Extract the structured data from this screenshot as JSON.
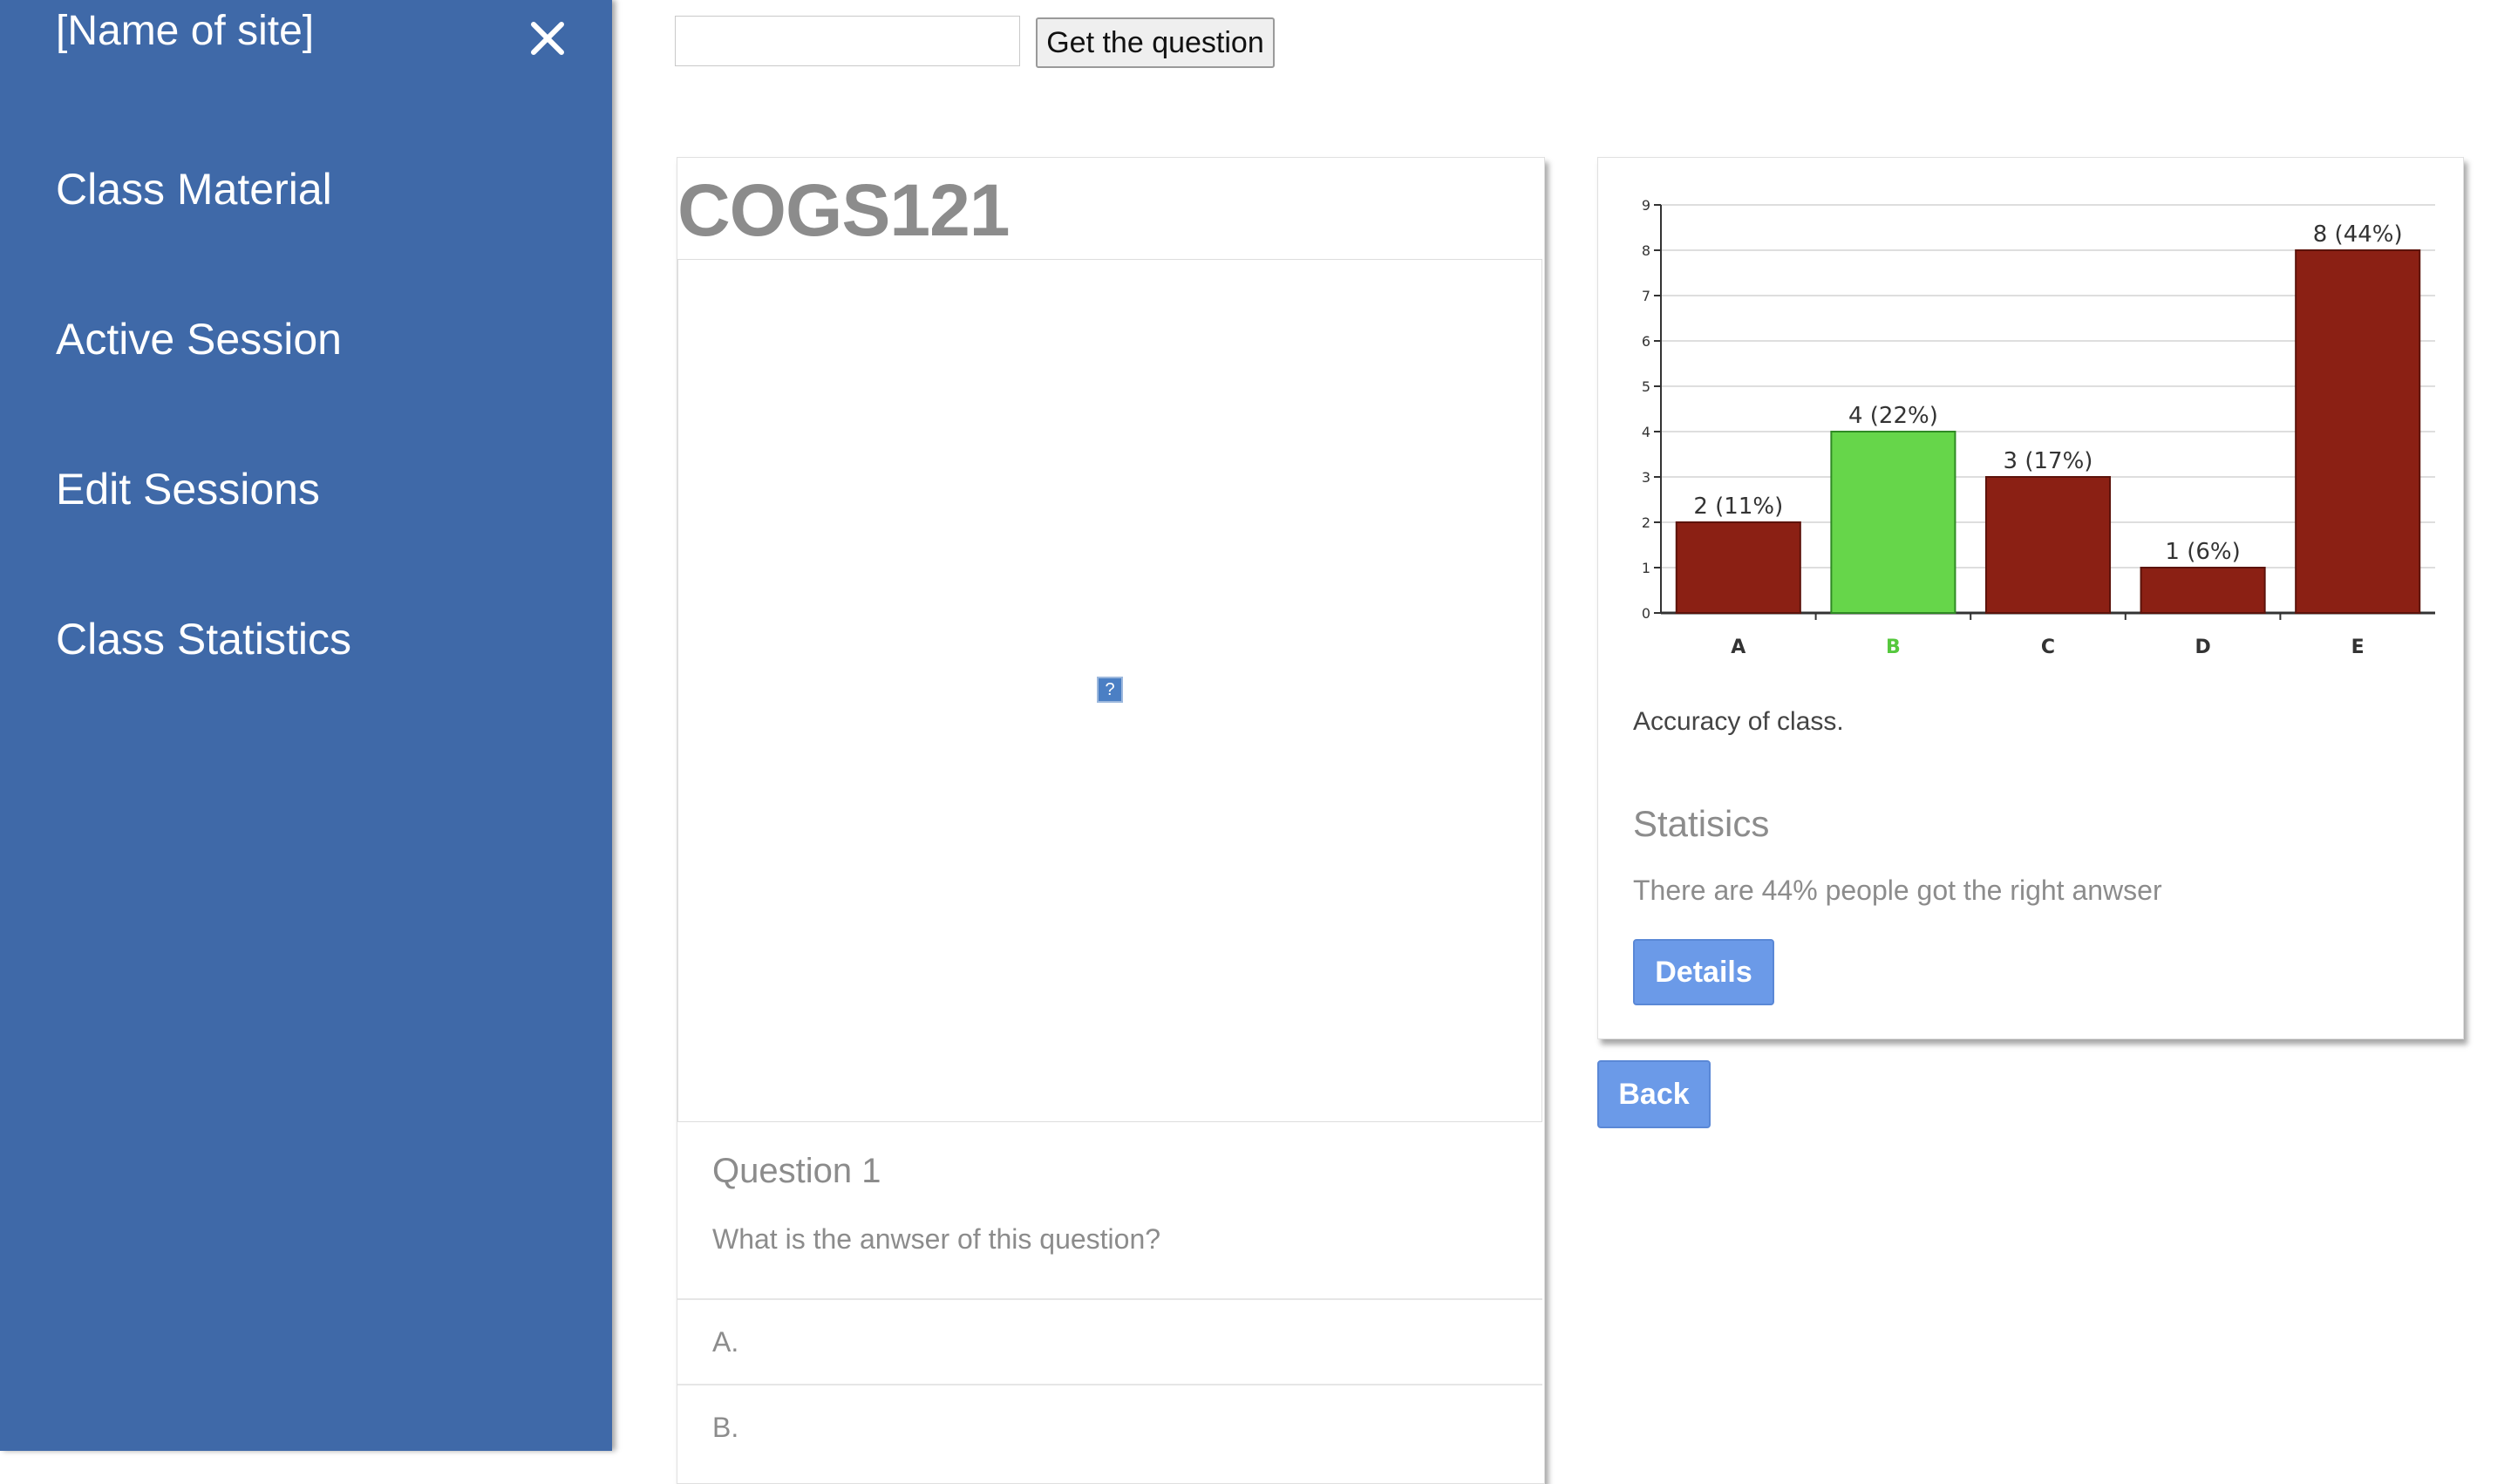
{
  "sidebar": {
    "site_name": "[Name of site]",
    "close_icon": "close-icon",
    "items": [
      {
        "label": "Class Material"
      },
      {
        "label": "Active Session"
      },
      {
        "label": "Edit Sessions"
      },
      {
        "label": "Class Statistics"
      }
    ]
  },
  "topbar": {
    "input_value": "",
    "button_label": "Get the question"
  },
  "question_card": {
    "course": "COGS121",
    "image_icon": "broken-image-icon",
    "question_label": "Question 1",
    "question_text": "What is the anwser of this question?",
    "options": [
      {
        "label": "A."
      },
      {
        "label": "B."
      }
    ]
  },
  "stats_card": {
    "caption": "Accuracy of class.",
    "heading": "Statisics",
    "text": "There are 44% people got the right anwser",
    "details_label": "Details"
  },
  "back_label": "Back",
  "colors": {
    "sidebar": "#3f69a8",
    "bar_wrong": "#8b2014",
    "bar_correct": "#66d64a",
    "button": "#6b9ae8"
  },
  "chart_data": {
    "type": "bar",
    "categories": [
      "A",
      "B",
      "C",
      "D",
      "E"
    ],
    "values": [
      2,
      4,
      3,
      1,
      8
    ],
    "value_labels": [
      "2 (11%)",
      "4 (22%)",
      "3 (17%)",
      "1 (6%)",
      "8 (44%)"
    ],
    "correct_category": "B",
    "ylim": [
      0,
      9
    ],
    "yticks": [
      0,
      1,
      2,
      3,
      4,
      5,
      6,
      7,
      8,
      9
    ],
    "grid": true
  }
}
